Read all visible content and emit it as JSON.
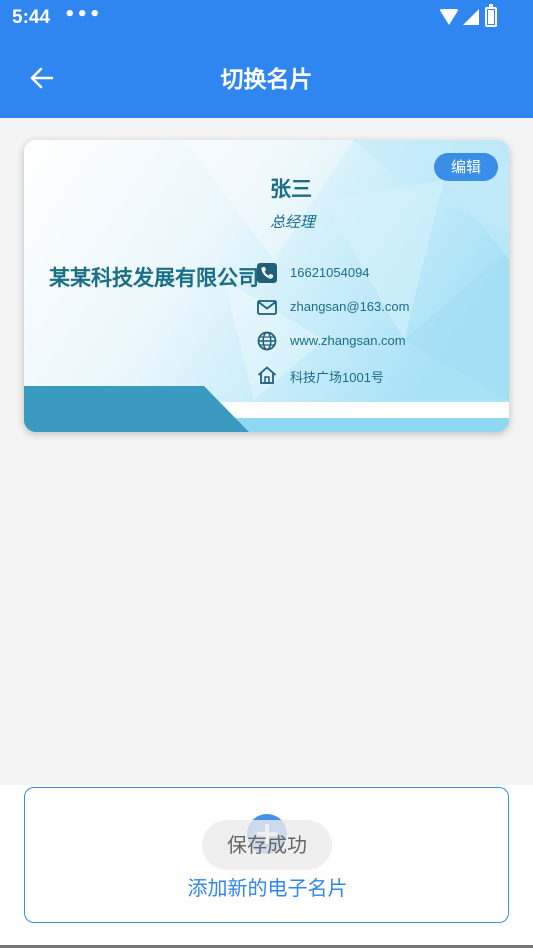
{
  "status_bar": {
    "time": "5:44",
    "dots": "•••"
  },
  "header": {
    "title": "切换名片"
  },
  "card": {
    "edit_label": "编辑",
    "company": "某某科技发展有限公司",
    "name": "张三",
    "title": "总经理",
    "phone": "16621054094",
    "email": "zhangsan@163.com",
    "website": "www.zhangsan.com",
    "address": "科技广场1001号"
  },
  "add_card": {
    "label": "添加新的电子名片"
  },
  "toast": {
    "text": "保存成功"
  },
  "colors": {
    "primary": "#2f86f0",
    "card_text": "#1a6e86",
    "card_accent": "#3a9ac0"
  }
}
